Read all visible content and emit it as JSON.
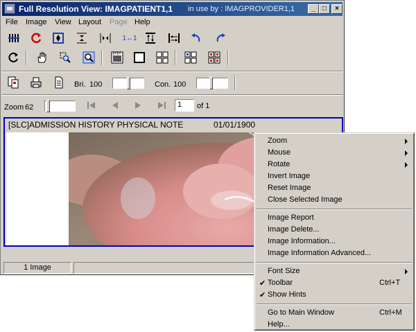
{
  "window": {
    "title": "Full Resolution View:  IMAGPATIENT1,1",
    "in_use": "in use by : IMAGPROVIDER1,1",
    "min_glyph": "_",
    "max_glyph": "□",
    "close_glyph": "×"
  },
  "menubar": {
    "items": [
      "File",
      "Image",
      "View",
      "Layout",
      "Page",
      "Help"
    ]
  },
  "toolbar": {
    "brightness_label": "Bri.",
    "brightness_value": "100",
    "contrast_label": "Con.",
    "contrast_value": "100",
    "zoom_label": "Zoom",
    "zoom_value": "62",
    "page_value": "1",
    "page_of": "of 1",
    "actual_size_label": "1↔1"
  },
  "viewer": {
    "caption": "[SLC]ADMISSION HISTORY  PHYSICAL NOTE",
    "date": "01/01/1900"
  },
  "statusbar": {
    "count": "1 Image"
  },
  "context_menu": {
    "items": [
      {
        "label": "Zoom",
        "submenu": true
      },
      {
        "label": "Mouse",
        "submenu": true
      },
      {
        "label": "Rotate",
        "submenu": true
      },
      {
        "label": "Invert Image"
      },
      {
        "label": "Reset Image"
      },
      {
        "label": "Close Selected Image"
      },
      {
        "label": "Image Report"
      },
      {
        "label": "Image Delete..."
      },
      {
        "label": "Image Information..."
      },
      {
        "label": "Image Information Advanced..."
      },
      {
        "label": "Font Size",
        "submenu": true
      },
      {
        "label": "Toolbar",
        "checked": true,
        "shortcut": "Ctrl+T"
      },
      {
        "label": "Show Hints",
        "checked": true
      },
      {
        "label": "Go to Main Window",
        "shortcut": "Ctrl+M"
      },
      {
        "label": "Help..."
      }
    ],
    "check_glyph": "✔"
  },
  "colors": {
    "title_start": "#0a246a",
    "title_end": "#3a6ea5",
    "viewer_border": "#0000c0",
    "face": "#d4d0c8"
  }
}
